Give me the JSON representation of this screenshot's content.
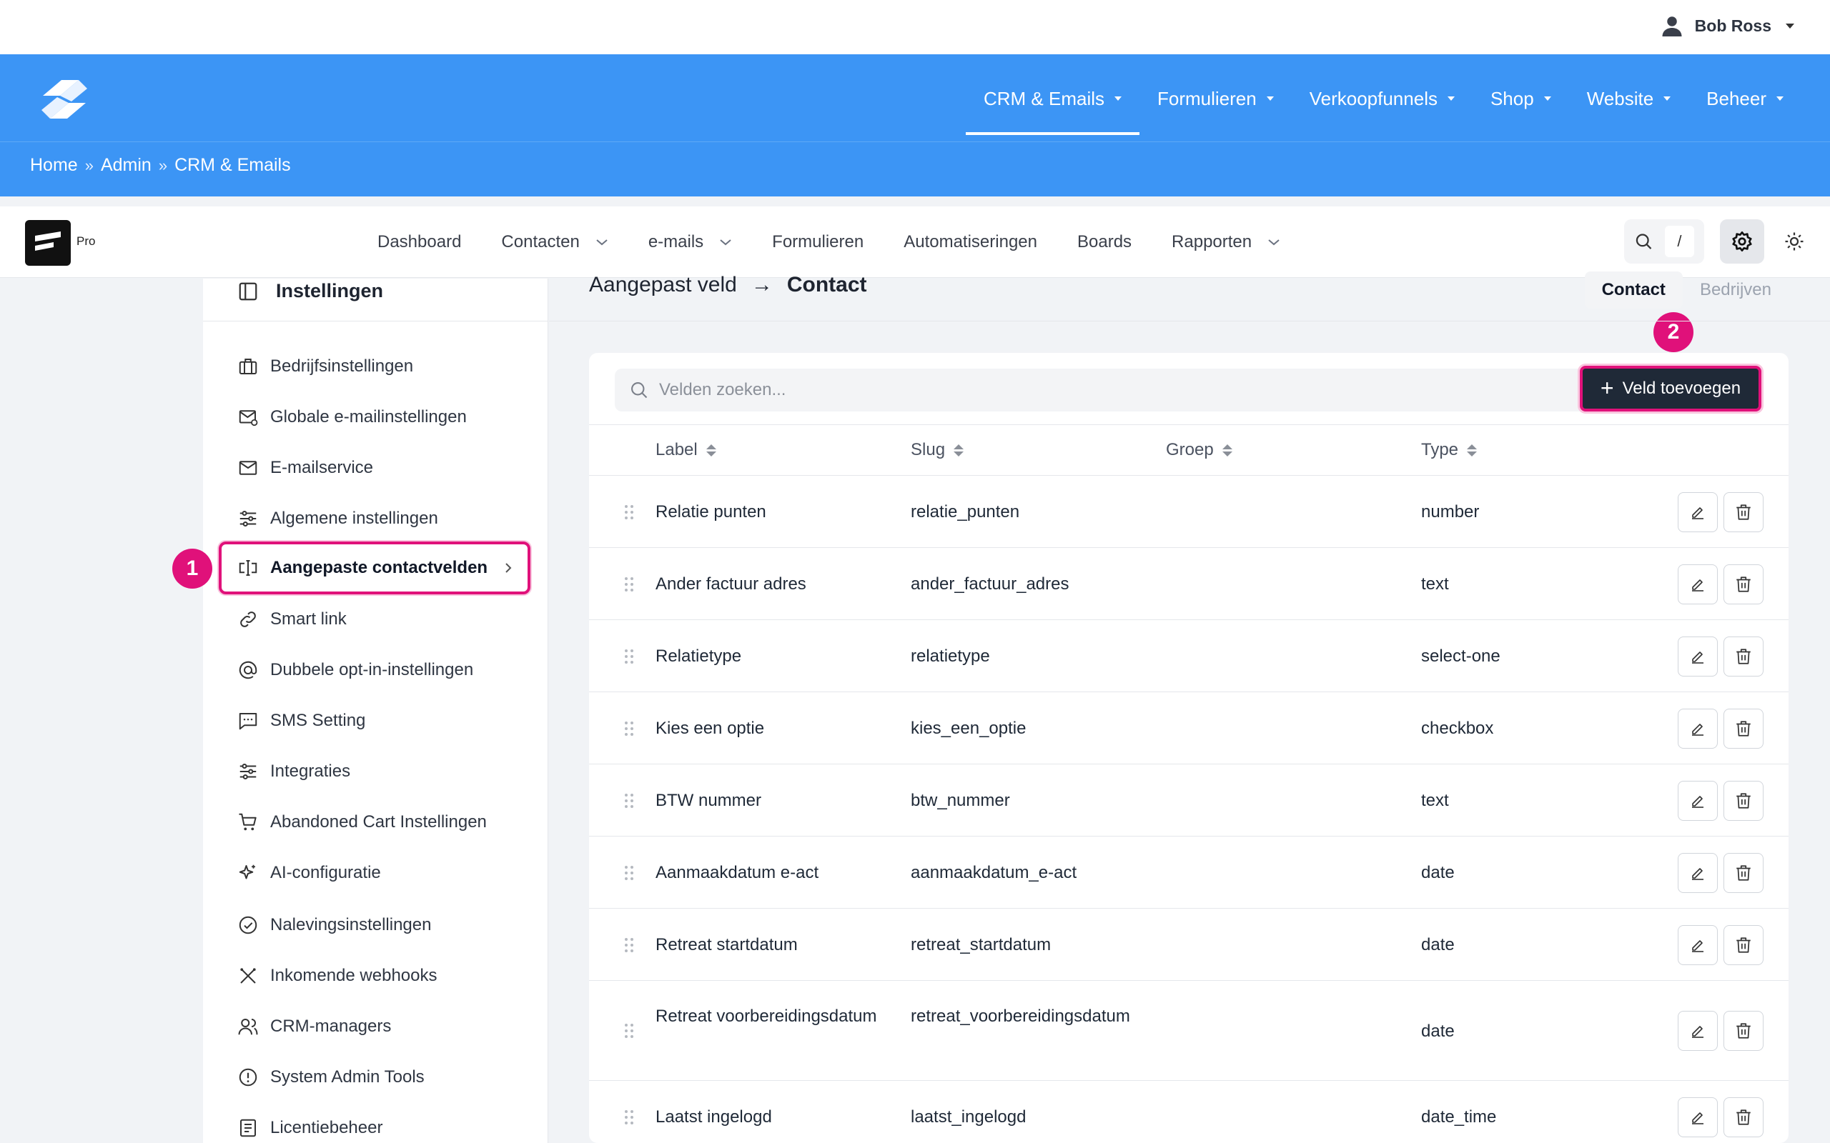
{
  "user": {
    "name": "Bob Ross"
  },
  "main_nav": [
    {
      "label": "CRM & Emails",
      "active": true
    },
    {
      "label": "Formulieren"
    },
    {
      "label": "Verkoopfunnels"
    },
    {
      "label": "Shop"
    },
    {
      "label": "Website"
    },
    {
      "label": "Beheer"
    }
  ],
  "breadcrumb": {
    "home": "Home",
    "sep": "»",
    "admin": "Admin",
    "current": "CRM & Emails"
  },
  "app": {
    "badge": "Pro",
    "nav": [
      {
        "label": "Dashboard"
      },
      {
        "label": "Contacten"
      },
      {
        "label": "e-mails"
      },
      {
        "label": "Formulieren"
      },
      {
        "label": "Automatiseringen"
      },
      {
        "label": "Boards"
      },
      {
        "label": "Rapporten"
      }
    ],
    "search_kbd": "/"
  },
  "sidebar": {
    "title": "Instellingen",
    "items": [
      {
        "label": "Bedrijfsinstellingen",
        "icon": "briefcase-icon"
      },
      {
        "label": "Globale e-mailinstellingen",
        "icon": "mail-settings-icon"
      },
      {
        "label": "E-mailservice",
        "icon": "mail-open-icon"
      },
      {
        "label": "Algemene instellingen",
        "icon": "sliders-icon"
      },
      {
        "label": "Aangepaste contactvelden",
        "icon": "text-cursor-icon",
        "active": true
      },
      {
        "label": "Smart link",
        "icon": "link-icon"
      },
      {
        "label": "Dubbele opt-in-instellingen",
        "icon": "at-icon"
      },
      {
        "label": "SMS Setting",
        "icon": "message-icon"
      },
      {
        "label": "Integraties",
        "icon": "sliders-icon"
      },
      {
        "label": "Abandoned Cart Instellingen",
        "icon": "cart-icon"
      },
      {
        "label": "AI-configuratie",
        "icon": "sparkle-icon"
      },
      {
        "label": "Nalevingsinstellingen",
        "icon": "check-circle-icon"
      },
      {
        "label": "Inkomende webhooks",
        "icon": "tools-icon"
      },
      {
        "label": "CRM-managers",
        "icon": "users-icon"
      },
      {
        "label": "System Admin Tools",
        "icon": "alert-circle-icon"
      },
      {
        "label": "Licentiebeheer",
        "icon": "license-icon"
      }
    ]
  },
  "annotations": {
    "one": "1",
    "two": "2"
  },
  "main": {
    "title_parent": "Aangepast veld",
    "title_arrow": "→",
    "title_current": "Contact",
    "tabs": [
      {
        "label": "Contact",
        "active": true
      },
      {
        "label": "Bedrijven"
      }
    ],
    "search_placeholder": "Velden zoeken...",
    "add_button": "Veld toevoegen",
    "columns": {
      "label": "Label",
      "slug": "Slug",
      "group": "Groep",
      "type": "Type"
    },
    "rows": [
      {
        "label": "Relatie punten",
        "slug": "relatie_punten",
        "group": "",
        "type": "number"
      },
      {
        "label": "Ander factuur adres",
        "slug": "ander_factuur_adres",
        "group": "",
        "type": "text"
      },
      {
        "label": "Relatietype",
        "slug": "relatietype",
        "group": "",
        "type": "select-one"
      },
      {
        "label": "Kies een optie",
        "slug": "kies_een_optie",
        "group": "",
        "type": "checkbox"
      },
      {
        "label": "BTW nummer",
        "slug": "btw_nummer",
        "group": "",
        "type": "text"
      },
      {
        "label": "Aanmaakdatum e-act",
        "slug": "aanmaakdatum_e-act",
        "group": "",
        "type": "date"
      },
      {
        "label": "Retreat startdatum",
        "slug": "retreat_startdatum",
        "group": "",
        "type": "date"
      },
      {
        "label": "Retreat voorbereidingsdatum",
        "slug": "retreat_voorbereidingsdatum",
        "group": "",
        "type": "date"
      },
      {
        "label": "Laatst ingelogd",
        "slug": "laatst_ingelogd",
        "group": "",
        "type": "date_time"
      }
    ]
  },
  "colors": {
    "brand_blue": "#3c95f5",
    "highlight": "#e0117a",
    "button_dark": "#1f2937"
  }
}
